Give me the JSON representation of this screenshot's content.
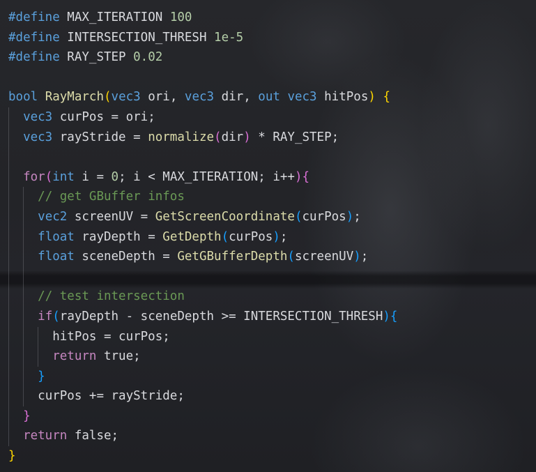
{
  "editor": {
    "language": "glsl",
    "theme_colors": {
      "background": "#1f2024",
      "text": "#d9dade",
      "keyword": "#5aa0dc",
      "control": "#c586c0",
      "function": "#dcdcaa",
      "number": "#b5cea8",
      "comment": "#6a9955",
      "bracket_level_1": "#ffd700",
      "bracket_level_2": "#da70d6",
      "bracket_level_3": "#179fff"
    },
    "lines": [
      {
        "indent": 0,
        "tokens": [
          {
            "t": "#define",
            "c": "pp"
          },
          {
            "t": " MAX_ITERATION ",
            "c": "txt"
          },
          {
            "t": "100",
            "c": "num"
          }
        ]
      },
      {
        "indent": 0,
        "tokens": [
          {
            "t": "#define",
            "c": "pp"
          },
          {
            "t": " INTERSECTION_THRESH ",
            "c": "txt"
          },
          {
            "t": "1e-5",
            "c": "num"
          }
        ]
      },
      {
        "indent": 0,
        "tokens": [
          {
            "t": "#define",
            "c": "pp"
          },
          {
            "t": " RAY_STEP ",
            "c": "txt"
          },
          {
            "t": "0.02",
            "c": "num"
          }
        ]
      },
      {
        "indent": 0,
        "tokens": []
      },
      {
        "indent": 0,
        "tokens": [
          {
            "t": "bool",
            "c": "kw"
          },
          {
            "t": " ",
            "c": "txt"
          },
          {
            "t": "RayMarch",
            "c": "fn"
          },
          {
            "t": "(",
            "c": "b1"
          },
          {
            "t": "vec3",
            "c": "kw"
          },
          {
            "t": " ori, ",
            "c": "txt"
          },
          {
            "t": "vec3",
            "c": "kw"
          },
          {
            "t": " dir, ",
            "c": "txt"
          },
          {
            "t": "out",
            "c": "kw"
          },
          {
            "t": " ",
            "c": "txt"
          },
          {
            "t": "vec3",
            "c": "kw"
          },
          {
            "t": " hitPos",
            "c": "txt"
          },
          {
            "t": ")",
            "c": "b1"
          },
          {
            "t": " ",
            "c": "txt"
          },
          {
            "t": "{",
            "c": "b1"
          }
        ]
      },
      {
        "indent": 1,
        "tokens": [
          {
            "t": "vec3",
            "c": "kw"
          },
          {
            "t": " curPos = ori;",
            "c": "txt"
          }
        ]
      },
      {
        "indent": 1,
        "tokens": [
          {
            "t": "vec3",
            "c": "kw"
          },
          {
            "t": " rayStride = ",
            "c": "txt"
          },
          {
            "t": "normalize",
            "c": "fn"
          },
          {
            "t": "(",
            "c": "b2"
          },
          {
            "t": "dir",
            "c": "txt"
          },
          {
            "t": ")",
            "c": "b2"
          },
          {
            "t": " * RAY_STEP;",
            "c": "txt"
          }
        ]
      },
      {
        "indent": 1,
        "tokens": []
      },
      {
        "indent": 1,
        "tokens": [
          {
            "t": "for",
            "c": "ctl"
          },
          {
            "t": "(",
            "c": "b2"
          },
          {
            "t": "int",
            "c": "kw"
          },
          {
            "t": " i = ",
            "c": "txt"
          },
          {
            "t": "0",
            "c": "num"
          },
          {
            "t": "; i < MAX_ITERATION; i++",
            "c": "txt"
          },
          {
            "t": ")",
            "c": "b2"
          },
          {
            "t": "{",
            "c": "b2"
          }
        ]
      },
      {
        "indent": 2,
        "tokens": [
          {
            "t": "// get GBuffer infos",
            "c": "cm"
          }
        ]
      },
      {
        "indent": 2,
        "tokens": [
          {
            "t": "vec2",
            "c": "kw"
          },
          {
            "t": " screenUV = ",
            "c": "txt"
          },
          {
            "t": "GetScreenCoordinate",
            "c": "fn"
          },
          {
            "t": "(",
            "c": "b3"
          },
          {
            "t": "curPos",
            "c": "txt"
          },
          {
            "t": ")",
            "c": "b3"
          },
          {
            "t": ";",
            "c": "txt"
          }
        ]
      },
      {
        "indent": 2,
        "tokens": [
          {
            "t": "float",
            "c": "kw"
          },
          {
            "t": " rayDepth = ",
            "c": "txt"
          },
          {
            "t": "GetDepth",
            "c": "fn"
          },
          {
            "t": "(",
            "c": "b3"
          },
          {
            "t": "curPos",
            "c": "txt"
          },
          {
            "t": ")",
            "c": "b3"
          },
          {
            "t": ";",
            "c": "txt"
          }
        ]
      },
      {
        "indent": 2,
        "tokens": [
          {
            "t": "float",
            "c": "kw"
          },
          {
            "t": " sceneDepth = ",
            "c": "txt"
          },
          {
            "t": "GetGBufferDepth",
            "c": "fn"
          },
          {
            "t": "(",
            "c": "b3"
          },
          {
            "t": "screenUV",
            "c": "txt"
          },
          {
            "t": ")",
            "c": "b3"
          },
          {
            "t": ";",
            "c": "txt"
          }
        ]
      },
      {
        "indent": 2,
        "tokens": []
      },
      {
        "indent": 2,
        "tokens": [
          {
            "t": "// test intersection",
            "c": "cm"
          }
        ]
      },
      {
        "indent": 2,
        "tokens": [
          {
            "t": "if",
            "c": "ctl"
          },
          {
            "t": "(",
            "c": "b3"
          },
          {
            "t": "rayDepth - sceneDepth >= INTERSECTION_THRESH",
            "c": "txt"
          },
          {
            "t": ")",
            "c": "b3"
          },
          {
            "t": "{",
            "c": "b3"
          }
        ]
      },
      {
        "indent": 3,
        "tokens": [
          {
            "t": "hitPos = curPos;",
            "c": "txt"
          }
        ]
      },
      {
        "indent": 3,
        "tokens": [
          {
            "t": "return",
            "c": "ctl"
          },
          {
            "t": " true;",
            "c": "txt"
          }
        ]
      },
      {
        "indent": 2,
        "tokens": [
          {
            "t": "}",
            "c": "b3"
          }
        ]
      },
      {
        "indent": 2,
        "tokens": [
          {
            "t": "curPos += rayStride;",
            "c": "txt"
          }
        ]
      },
      {
        "indent": 1,
        "tokens": [
          {
            "t": "}",
            "c": "b2"
          }
        ]
      },
      {
        "indent": 1,
        "tokens": [
          {
            "t": "return",
            "c": "ctl"
          },
          {
            "t": " false;",
            "c": "txt"
          }
        ]
      },
      {
        "indent": 0,
        "tokens": [
          {
            "t": "}",
            "c": "b1"
          }
        ]
      }
    ]
  }
}
